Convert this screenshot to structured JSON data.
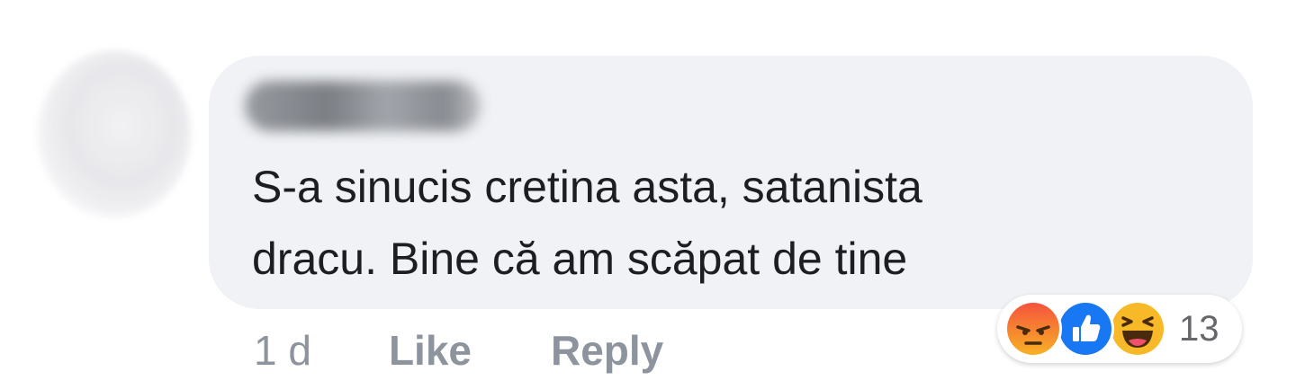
{
  "comment": {
    "author_name": "",
    "text": "S-a sinucis cretina asta, satanista\ndracu. Bine că am scăpat de tine"
  },
  "meta": {
    "time": "1 d",
    "like_label": "Like",
    "reply_label": "Reply"
  },
  "reactions": {
    "icons": [
      "angry-icon",
      "like-icon",
      "haha-icon"
    ],
    "count": "13"
  },
  "colors": {
    "bubble": "#f0f2f5",
    "text": "#1c1e21",
    "muted": "#8d949e",
    "like_blue": "#1877f2",
    "angry_top": "#f5533d",
    "angry_bottom": "#f7b125",
    "haha_yellow": "#f7b928"
  }
}
